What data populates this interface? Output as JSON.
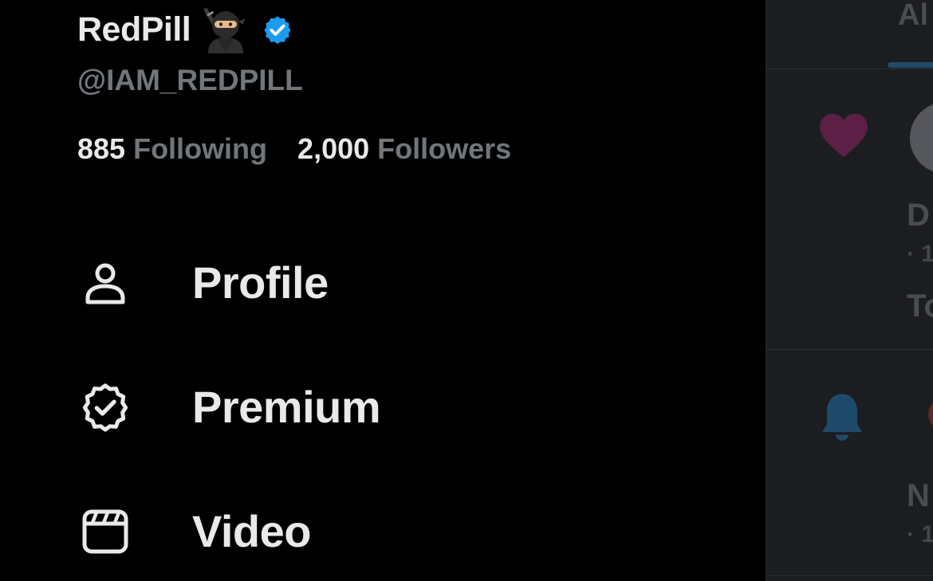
{
  "profile": {
    "display_name": "RedPill",
    "emoji": "ninja",
    "verified": true,
    "handle": "@IAM_REDPILL",
    "following_count": "885",
    "following_label": "Following",
    "followers_count": "2,000",
    "followers_label": "Followers"
  },
  "menu": {
    "items": [
      {
        "label": "Profile",
        "icon": "person-icon"
      },
      {
        "label": "Premium",
        "icon": "verified-badge-icon"
      },
      {
        "label": "Video",
        "icon": "video-clapper-icon"
      }
    ]
  },
  "background_panel": {
    "tab_partial": "Al",
    "row1_title_partial": "D",
    "row1_meta_partial": "· 1",
    "row1_text_partial": "To",
    "row2_title_partial": "N",
    "row2_meta_partial": "· 1"
  },
  "colors": {
    "background": "#000000",
    "primary_text": "#e7e9ea",
    "secondary_text": "#71767b",
    "verified_blue": "#1d9bf0",
    "dimmed_panel": "#1c1d20"
  }
}
